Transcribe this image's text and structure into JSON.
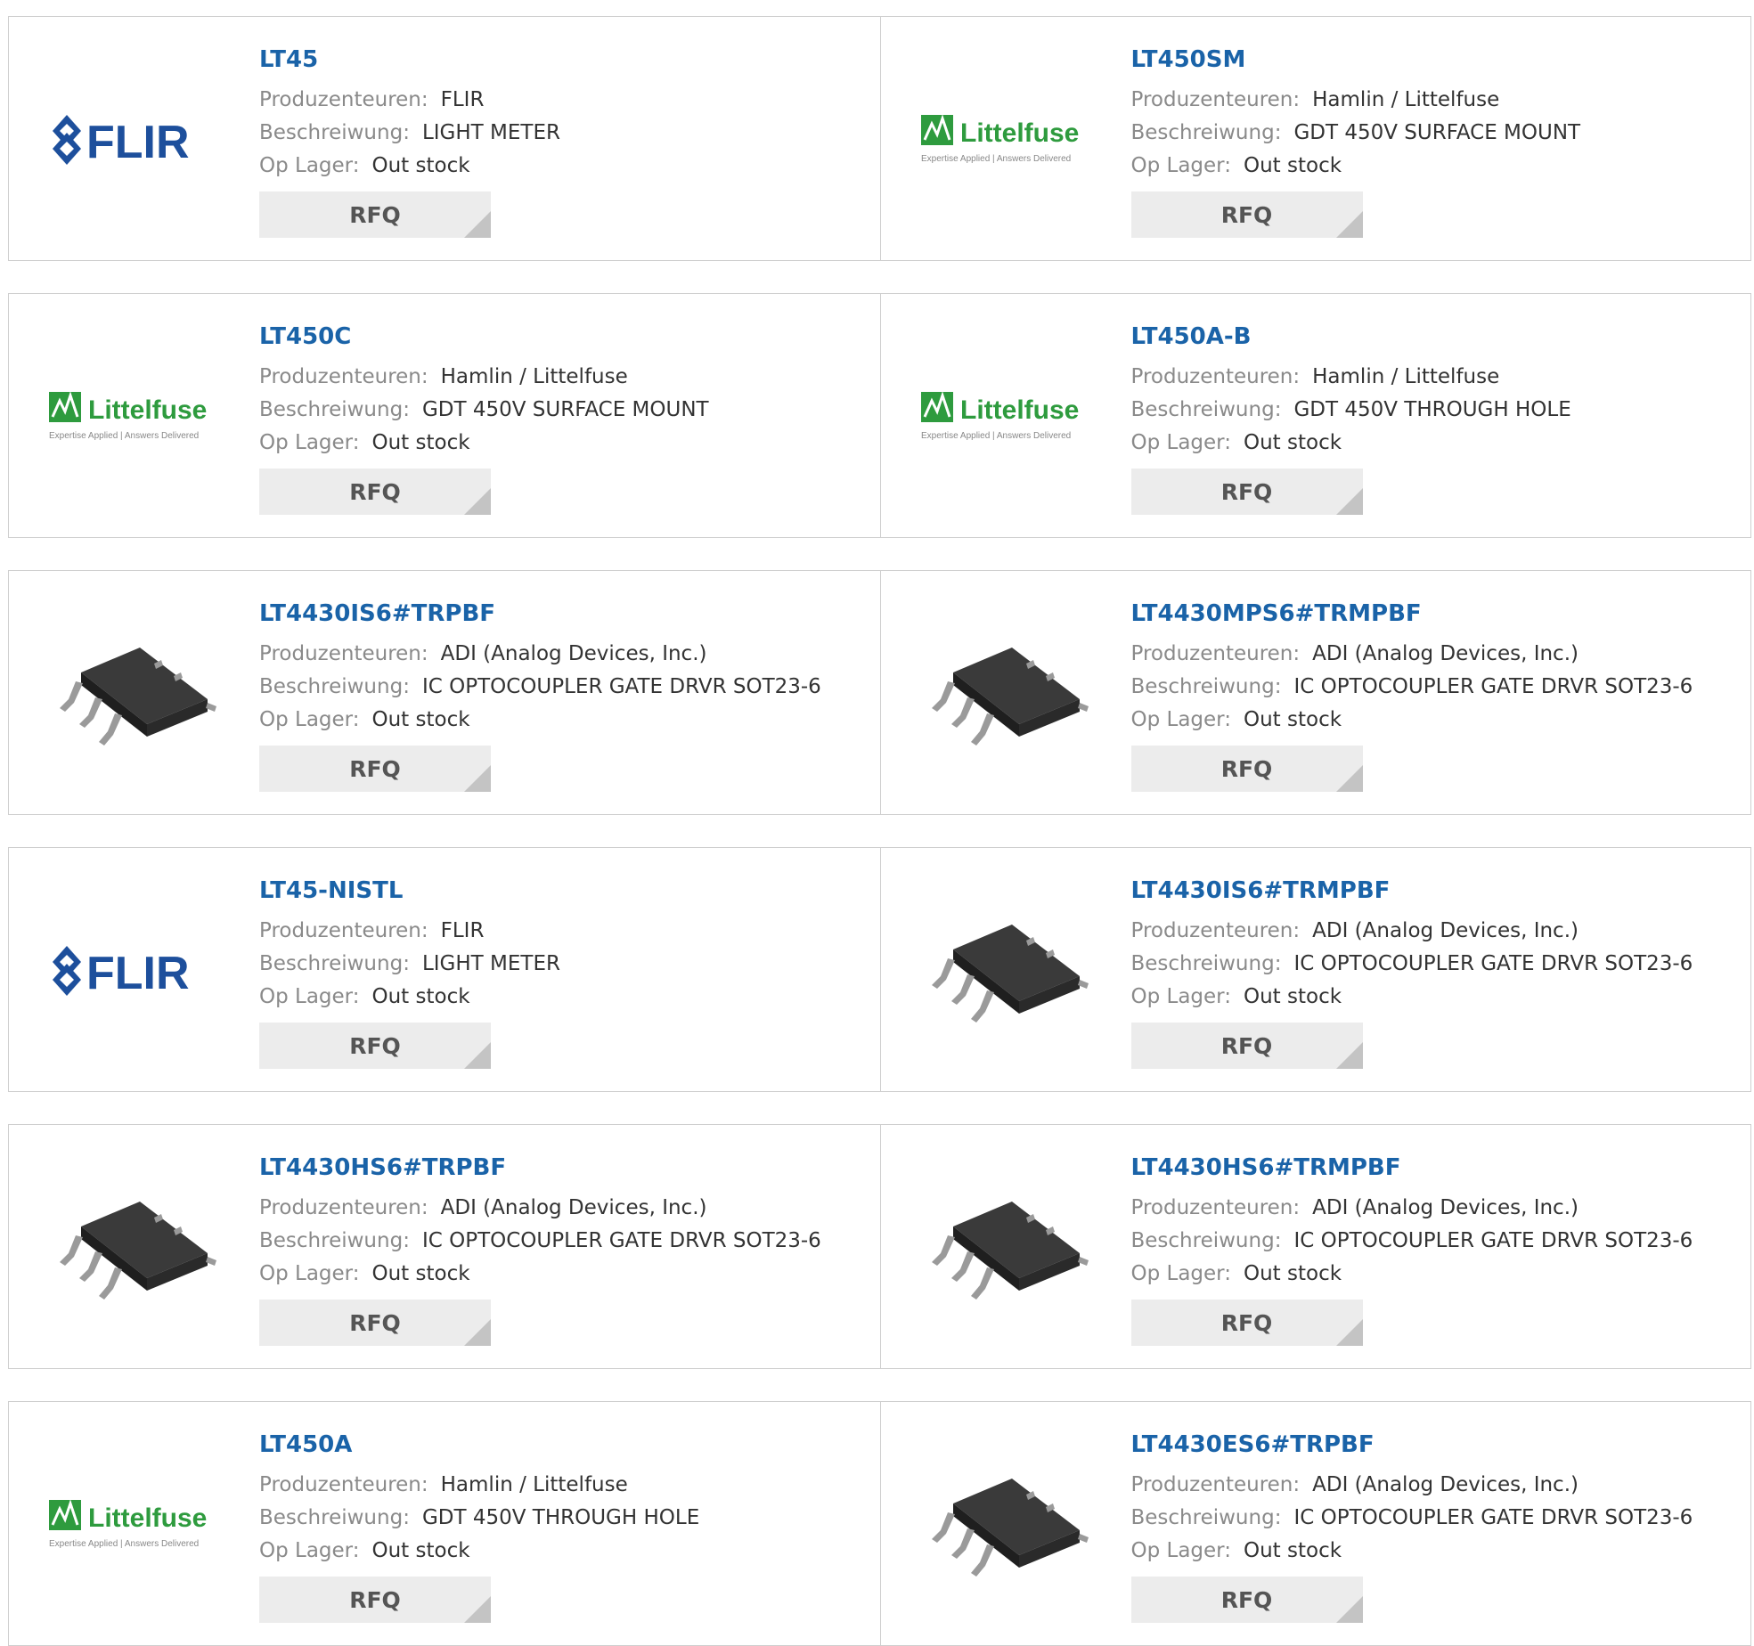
{
  "labels": {
    "manufacturer": "Produzenteuren:",
    "description": "Beschreiwung:",
    "stock": "Op Lager:",
    "rfq": "RFQ"
  },
  "colors": {
    "link": "#1a63a8",
    "flir_blue": "#1d4f9c",
    "littelfuse_green": "#2e9b3e",
    "chip": "#2d2d2d"
  },
  "logos": {
    "flir": {
      "text": "FLIR"
    },
    "littelfuse": {
      "text": "Littelfuse",
      "tagline": "Expertise Applied | Answers Delivered"
    }
  },
  "products": [
    {
      "part": "LT45",
      "image": "flir-logo",
      "manufacturer": "FLIR",
      "description": "LIGHT METER",
      "stock": "Out stock"
    },
    {
      "part": "LT450SM",
      "image": "littelfuse-logo",
      "manufacturer": "Hamlin / Littelfuse",
      "description": "GDT 450V SURFACE MOUNT",
      "stock": "Out stock"
    },
    {
      "part": "LT450C",
      "image": "littelfuse-logo",
      "manufacturer": "Hamlin / Littelfuse",
      "description": "GDT 450V SURFACE MOUNT",
      "stock": "Out stock"
    },
    {
      "part": "LT450A-B",
      "image": "littelfuse-logo",
      "manufacturer": "Hamlin / Littelfuse",
      "description": "GDT 450V THROUGH HOLE",
      "stock": "Out stock"
    },
    {
      "part": "LT4430IS6#TRPBF",
      "image": "sot23-chip",
      "manufacturer": "ADI (Analog Devices, Inc.)",
      "description": "IC OPTOCOUPLER GATE DRVR SOT23-6",
      "stock": "Out stock"
    },
    {
      "part": "LT4430MPS6#TRMPBF",
      "image": "sot23-chip",
      "manufacturer": "ADI (Analog Devices, Inc.)",
      "description": "IC OPTOCOUPLER GATE DRVR SOT23-6",
      "stock": "Out stock"
    },
    {
      "part": "LT45-NISTL",
      "image": "flir-logo",
      "manufacturer": "FLIR",
      "description": "LIGHT METER",
      "stock": "Out stock"
    },
    {
      "part": "LT4430IS6#TRMPBF",
      "image": "sot23-chip",
      "manufacturer": "ADI (Analog Devices, Inc.)",
      "description": "IC OPTOCOUPLER GATE DRVR SOT23-6",
      "stock": "Out stock"
    },
    {
      "part": "LT4430HS6#TRPBF",
      "image": "sot23-chip",
      "manufacturer": "ADI (Analog Devices, Inc.)",
      "description": "IC OPTOCOUPLER GATE DRVR SOT23-6",
      "stock": "Out stock"
    },
    {
      "part": "LT4430HS6#TRMPBF",
      "image": "sot23-chip",
      "manufacturer": "ADI (Analog Devices, Inc.)",
      "description": "IC OPTOCOUPLER GATE DRVR SOT23-6",
      "stock": "Out stock"
    },
    {
      "part": "LT450A",
      "image": "littelfuse-logo",
      "manufacturer": "Hamlin / Littelfuse",
      "description": "GDT 450V THROUGH HOLE",
      "stock": "Out stock"
    },
    {
      "part": "LT4430ES6#TRPBF",
      "image": "sot23-chip",
      "manufacturer": "ADI (Analog Devices, Inc.)",
      "description": "IC OPTOCOUPLER GATE DRVR SOT23-6",
      "stock": "Out stock"
    }
  ]
}
